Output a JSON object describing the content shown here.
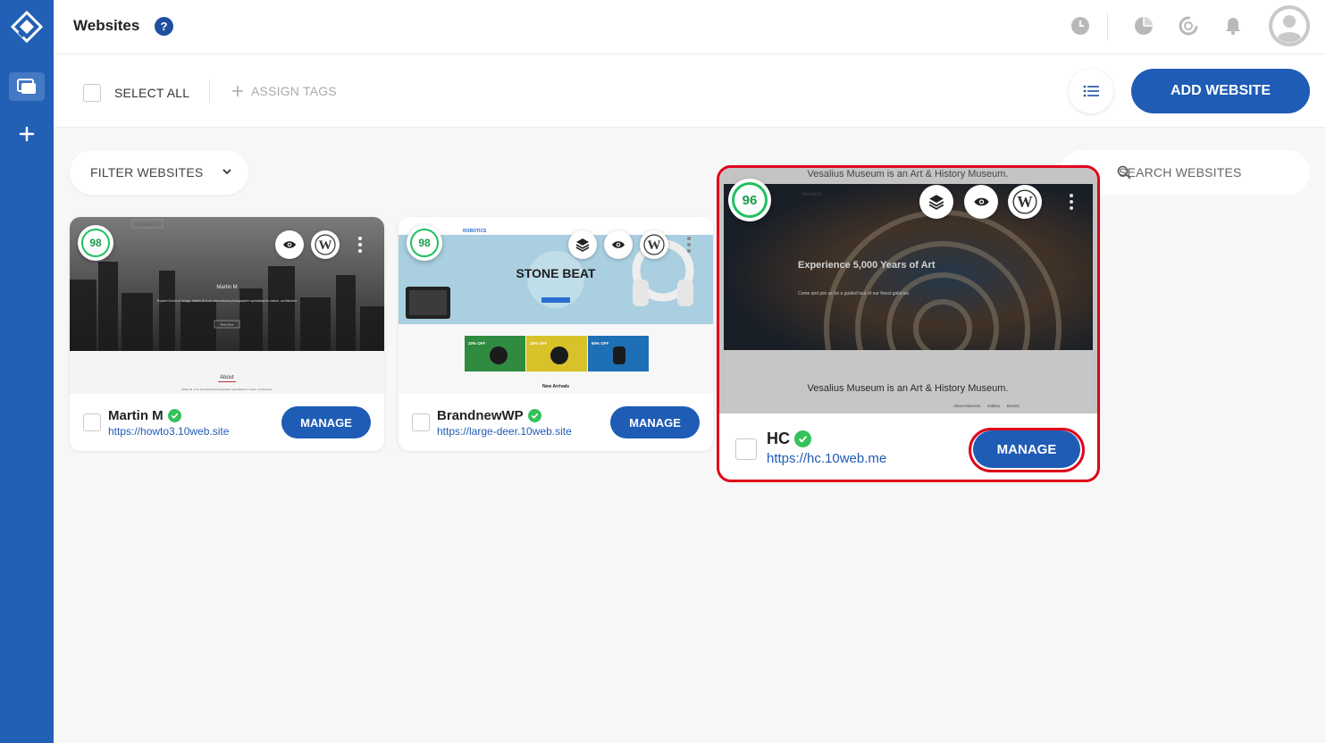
{
  "header": {
    "title": "Websites",
    "help_label": "?"
  },
  "toolbar": {
    "select_all_label": "SELECT ALL",
    "assign_tags_label": "ASSIGN TAGS",
    "add_website_label": "ADD WEBSITE"
  },
  "filter": {
    "label": "FILTER WEBSITES"
  },
  "search": {
    "placeholder": "SEARCH WEBSITES"
  },
  "sites": [
    {
      "name": "Martin M",
      "url": "https://howto3.10web.site",
      "score": "98",
      "manage_label": "MANAGE",
      "thumb_texts": [
        "MARTIN M",
        "Martin M",
        "Explore World of Design. Martin M is an international photographer specialised in nature, architecture",
        "Read More",
        "About",
        "Martin M. is an international photographer specialised in nature, architecture"
      ]
    },
    {
      "name": "BrandnewWP",
      "url": "https://large-deer.10web.site",
      "score": "98",
      "manage_label": "MANAGE",
      "thumb_texts": [
        "ROBOTICS",
        "STONE BEAT",
        "20% OFF",
        "30% OFF",
        "60% OFF",
        "New Arrivals"
      ]
    },
    {
      "name": "HC",
      "url": "https://hc.10web.me",
      "score": "96",
      "manage_label": "MANAGE",
      "thumb_texts": [
        "Vesalius Museum is an Art & History Museum.",
        "Vesalius",
        "Experience 5,000 Years of Art",
        "Come and join us for a guided tour of our finest galleries",
        "Vesalius Museum is an Art & History Museum.",
        "About Museum",
        "Gallery",
        "Events"
      ]
    }
  ],
  "colors": {
    "brand": "#1f5cb5",
    "sidebar": "#2160b5",
    "score_green": "#20c060",
    "highlight": "#e0001b"
  }
}
